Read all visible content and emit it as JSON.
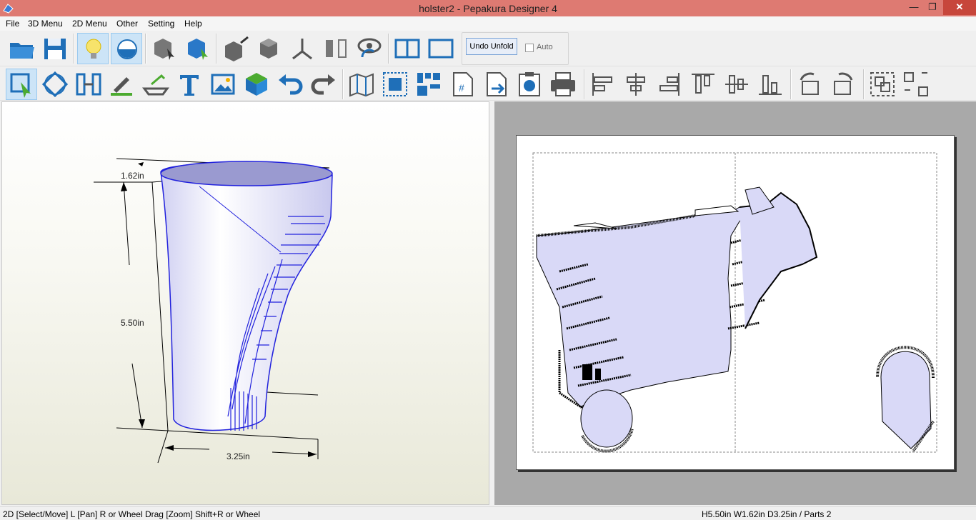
{
  "window": {
    "title": "holster2 - Pepakura Designer 4",
    "minimize": "—",
    "maximize": "❐",
    "close": "✕"
  },
  "menu": {
    "file": "File",
    "menu3d": "3D Menu",
    "menu2d": "2D Menu",
    "other": "Other",
    "setting": "Setting",
    "help": "Help"
  },
  "toolbar": {
    "undo_unfold": "Undo Unfold",
    "auto": "Auto"
  },
  "view3d": {
    "dim_depth": "1.62in",
    "dim_height": "5.50in",
    "dim_width": "3.25in"
  },
  "status": {
    "left": "2D [Select/Move] L [Pan] R or Wheel Drag [Zoom] Shift+R or Wheel",
    "right": "H5.50in W1.62in D3.25in / Parts 2"
  },
  "colors": {
    "titlebar": "#de7a72",
    "face": "#d9d9f7",
    "edge": "#2222dd",
    "paper_bg": "#a9a9a9"
  },
  "icons": [
    "open-folder-icon",
    "save-icon",
    "light-bulb-icon",
    "texture-toggle-icon",
    "rotate-select-icon",
    "select-part-icon",
    "add-flap-icon",
    "cylinder-icon",
    "axis-icon",
    "split-view-icon",
    "view-eye-icon",
    "dual-pane-icon",
    "single-pane-icon",
    "select-move-icon",
    "rotate-icon",
    "join-split-icon",
    "edit-line-icon",
    "fold-line-icon",
    "text-icon",
    "image-icon",
    "cube-icon",
    "undo-icon",
    "redo-icon",
    "unfold-icon",
    "fit-page-icon",
    "arrange-icon",
    "page-number-icon",
    "export-icon",
    "clipboard-icon",
    "print-icon",
    "align-left-icon",
    "align-center-icon",
    "align-right-icon",
    "align-top-icon",
    "align-middle-icon",
    "align-bottom-icon",
    "rotate-left-icon",
    "rotate-right-icon",
    "group-icon",
    "ungroup-icon"
  ]
}
